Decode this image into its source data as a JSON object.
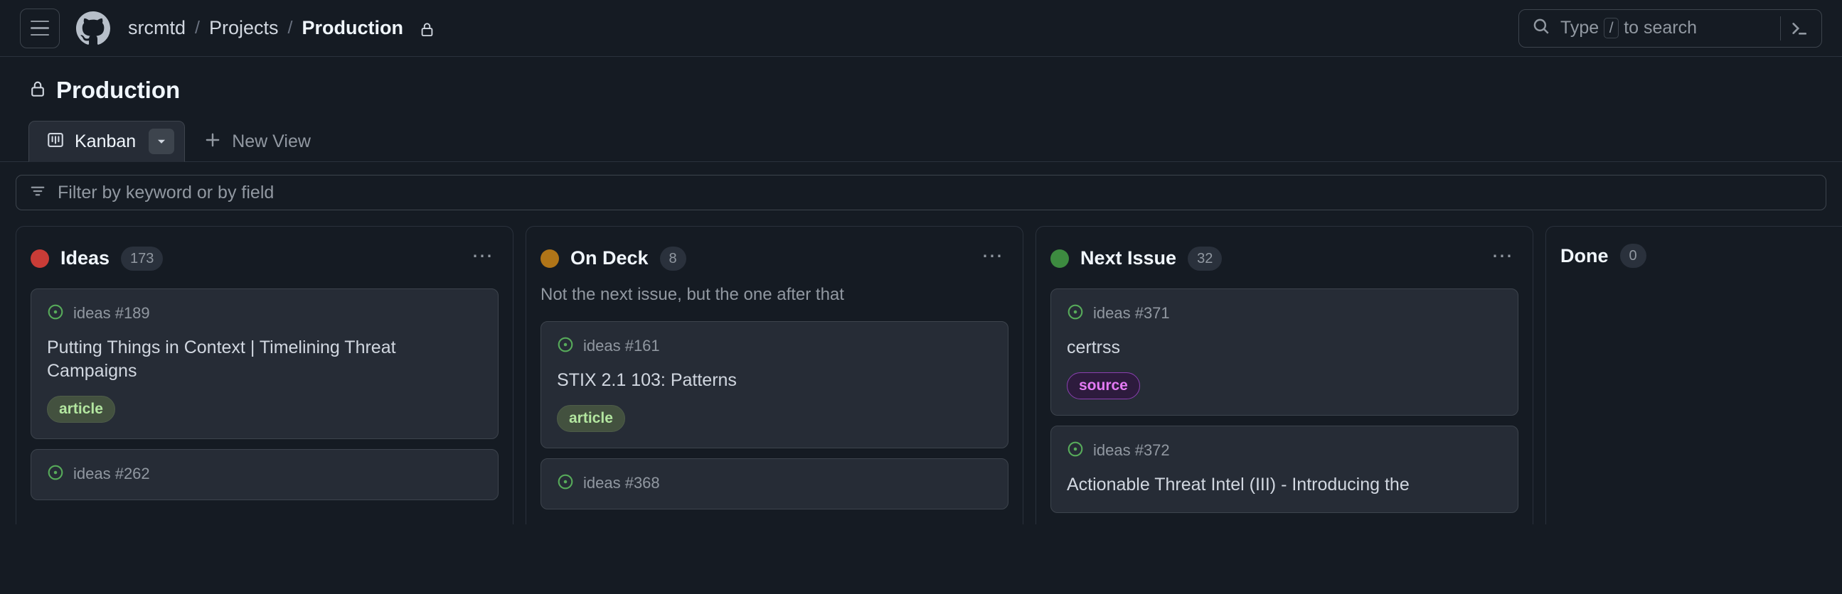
{
  "header": {
    "menu_icon": "hamburger-menu-icon",
    "logo_icon": "github-logo-icon",
    "breadcrumb": {
      "owner": "srcmtd",
      "sep": "/",
      "section": "Projects",
      "current": "Production",
      "lock_icon": "lock-icon"
    },
    "search": {
      "icon": "search-icon",
      "placeholder_prefix": "Type",
      "key": "/",
      "placeholder_suffix": "to search",
      "terminal_icon": "terminal-icon"
    }
  },
  "project": {
    "lock_icon": "lock-icon",
    "title": "Production"
  },
  "tabs": {
    "active": {
      "icon": "kanban-board-icon",
      "label": "Kanban",
      "caret_icon": "chevron-down-icon"
    },
    "new_view": {
      "icon": "plus-icon",
      "label": "New View"
    }
  },
  "filter": {
    "icon": "filter-icon",
    "placeholder": "Filter by keyword or by field"
  },
  "board": {
    "columns": [
      {
        "name": "Ideas",
        "count": "173",
        "dot_color": "#c93c37",
        "description": "",
        "menu_icon": "kebab-menu-icon",
        "cards": [
          {
            "meta": "ideas #189",
            "status_icon": "issue-opened-icon",
            "title": "Putting Things in Context | Timelining Threat Campaigns",
            "labels": [
              {
                "text": "article",
                "kind": "article"
              }
            ]
          },
          {
            "meta": "ideas #262",
            "status_icon": "issue-opened-icon",
            "title": "",
            "labels": []
          }
        ]
      },
      {
        "name": "On Deck",
        "count": "8",
        "dot_color": "#b07518",
        "description": "Not the next issue, but the one after that",
        "menu_icon": "kebab-menu-icon",
        "cards": [
          {
            "meta": "ideas #161",
            "status_icon": "issue-opened-icon",
            "title": "STIX 2.1 103: Patterns",
            "labels": [
              {
                "text": "article",
                "kind": "article"
              }
            ]
          },
          {
            "meta": "ideas #368",
            "status_icon": "issue-opened-icon",
            "title": "",
            "labels": []
          }
        ]
      },
      {
        "name": "Next Issue",
        "count": "32",
        "dot_color": "#3d8b40",
        "description": "",
        "menu_icon": "kebab-menu-icon",
        "cards": [
          {
            "meta": "ideas #371",
            "status_icon": "issue-opened-icon",
            "title": "certrss",
            "labels": [
              {
                "text": "source",
                "kind": "source"
              }
            ]
          },
          {
            "meta": "ideas #372",
            "status_icon": "issue-opened-icon",
            "title": "Actionable Threat Intel (III) - Introducing the",
            "labels": []
          }
        ]
      },
      {
        "name": "Done",
        "count": "0",
        "dot_color": "",
        "description": "",
        "menu_icon": "",
        "cards": []
      }
    ]
  }
}
